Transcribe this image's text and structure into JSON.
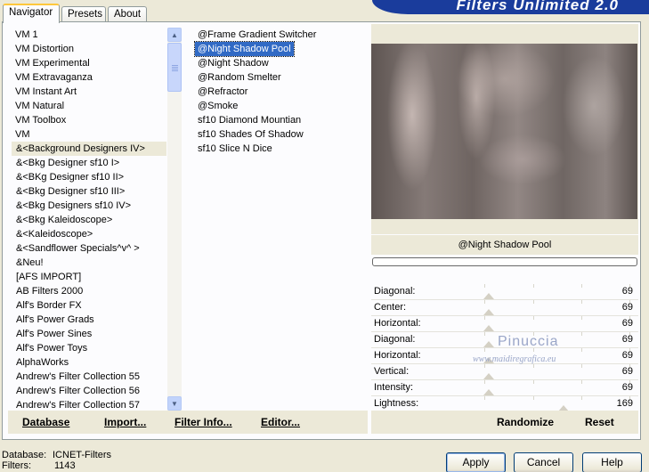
{
  "banner": {
    "title": "Filters Unlimited 2.0"
  },
  "tabs": [
    {
      "label": "Navigator",
      "active": true
    },
    {
      "label": "Presets",
      "active": false
    },
    {
      "label": "About",
      "active": false
    }
  ],
  "categories": {
    "items": [
      "VM 1",
      "VM Distortion",
      "VM Experimental",
      "VM Extravaganza",
      "VM Instant Art",
      "VM Natural",
      "VM Toolbox",
      "VM",
      "&<Background Designers IV>",
      "&<Bkg Designer sf10 I>",
      "&<BKg Designer sf10 II>",
      "&<Bkg Designer sf10 III>",
      "&<Bkg Designers sf10 IV>",
      "&<Bkg Kaleidoscope>",
      "&<Kaleidoscope>",
      "&<Sandflower Specials^v^ >",
      "&Neu!",
      "[AFS IMPORT]",
      "AB Filters 2000",
      "Alf's Border FX",
      "Alf's Power Grads",
      "Alf's Power Sines",
      "Alf's Power Toys",
      "AlphaWorks",
      "Andrew's Filter Collection 55",
      "Andrew's Filter Collection 56",
      "Andrew's Filter Collection 57"
    ],
    "selected_index": 8
  },
  "filters": {
    "items": [
      "@Frame Gradient Switcher",
      "@Night Shadow Pool",
      "@Night Shadow",
      "@Random Smelter",
      "@Refractor",
      "@Smoke",
      "sf10 Diamond Mountian",
      "sf10 Shades Of Shadow",
      "sf10 Slice N Dice"
    ],
    "selected_index": 1
  },
  "left_buttons": {
    "database": "Database",
    "import": "Import...",
    "filter_info": "Filter Info...",
    "editor": "Editor..."
  },
  "preview": {
    "filter_name": "@Night Shadow Pool",
    "progress": 0
  },
  "sliders": [
    {
      "label": "Diagonal:",
      "value": "69",
      "level": 0.27
    },
    {
      "label": "Center:",
      "value": "69",
      "level": 0.27
    },
    {
      "label": "Horizontal:",
      "value": "69",
      "level": 0.27
    },
    {
      "label": "Diagonal:",
      "value": "69",
      "level": 0.27
    },
    {
      "label": "Horizontal:",
      "value": "69",
      "level": 0.27
    },
    {
      "label": "Vertical:",
      "value": "69",
      "level": 0.27
    },
    {
      "label": "Intensity:",
      "value": "69",
      "level": 0.27
    },
    {
      "label": "Lightness:",
      "value": "169",
      "level": 0.66
    }
  ],
  "watermark": {
    "name": "Pinuccia",
    "site": "www.maidiregrafica.eu"
  },
  "right_buttons": {
    "randomize": "Randomize",
    "reset": "Reset"
  },
  "status": {
    "database_label": "Database:",
    "database_value": "ICNET-Filters",
    "filters_label": "Filters:",
    "filters_value": "1143"
  },
  "dialog": {
    "apply": "Apply",
    "cancel": "Cancel",
    "help": "Help"
  }
}
